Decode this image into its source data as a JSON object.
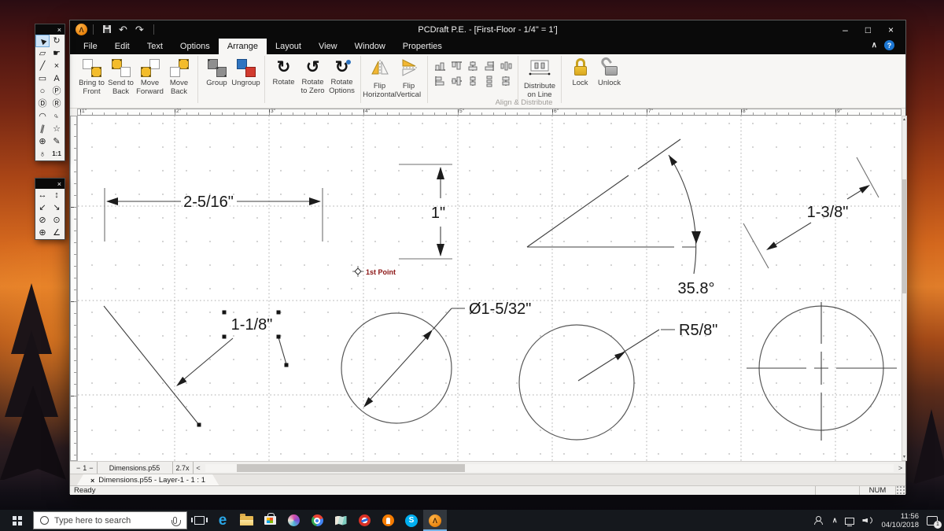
{
  "titlebar": {
    "title": "PCDraft P.E. - [First-Floor - 1/4\" = 1']",
    "minimize": "–",
    "maximize": "□",
    "close": "×",
    "undo": "↶",
    "redo": "↷"
  },
  "menu": {
    "tabs": [
      "File",
      "Edit",
      "Text",
      "Options",
      "Arrange",
      "Layout",
      "View",
      "Window",
      "Properties"
    ],
    "collapse_glyph": "∧",
    "help_glyph": "?"
  },
  "ribbon": {
    "group_label": "Align & Distribute",
    "bring_to_front": "Bring to Front",
    "send_to_back": "Send to Back",
    "move_forward": "Move Forward",
    "move_back": "Move Back",
    "group": "Group",
    "ungroup": "Ungroup",
    "rotate": "Rotate",
    "rotate_to_zero": "Rotate to Zero",
    "rotate_options": "Rotate Options",
    "rotate_glyph": "↻",
    "rotate_zero_glyph": "↺",
    "rotate_options_glyph": "↻",
    "flip_horizontal": "Flip Horizontal",
    "flip_vertical": "Flip Vertical",
    "distribute_on_line": "Distribute on Line",
    "lock": "Lock",
    "unlock": "Unlock"
  },
  "palette1": {
    "close": "×",
    "tools": [
      {
        "name": "select",
        "glyph": "▶"
      },
      {
        "name": "rotate",
        "glyph": "↻"
      },
      {
        "name": "reshape",
        "glyph": "▱"
      },
      {
        "name": "pan",
        "glyph": "☛"
      },
      {
        "name": "line",
        "glyph": "╱"
      },
      {
        "name": "break",
        "glyph": "×"
      },
      {
        "name": "rectangle",
        "glyph": "▭"
      },
      {
        "name": "text",
        "glyph": "A"
      },
      {
        "name": "ellipse",
        "glyph": "○"
      },
      {
        "name": "polygon",
        "glyph": "Ⓟ"
      },
      {
        "name": "door",
        "glyph": "Ⓓ"
      },
      {
        "name": "roof",
        "glyph": "Ⓡ"
      },
      {
        "name": "freeform",
        "glyph": "◠"
      },
      {
        "name": "mirror",
        "glyph": "♀"
      },
      {
        "name": "parallel-lines",
        "glyph": "∥"
      },
      {
        "name": "star",
        "glyph": "☆"
      },
      {
        "name": "symbol",
        "glyph": "⊕"
      },
      {
        "name": "pen",
        "glyph": "✎"
      },
      {
        "name": "callout",
        "glyph": "♁"
      },
      {
        "name": "actual-size",
        "glyph": "1:1"
      }
    ]
  },
  "palette2": {
    "close": "×",
    "tools": [
      {
        "name": "dim-horizontal",
        "glyph": "↔"
      },
      {
        "name": "dim-vertical",
        "glyph": "↕"
      },
      {
        "name": "dim-aligned",
        "glyph": "↙"
      },
      {
        "name": "dim-rotated",
        "glyph": "↘"
      },
      {
        "name": "dim-diameter",
        "glyph": "⊘"
      },
      {
        "name": "dim-radius",
        "glyph": "⊙"
      },
      {
        "name": "center-mark",
        "glyph": "⊕"
      },
      {
        "name": "dim-angle",
        "glyph": "∠"
      }
    ]
  },
  "ruler": {
    "labels": [
      "1\"",
      "2\"",
      "3\"",
      "4\"",
      "5\"",
      "6\"",
      "7\"",
      "8\"",
      "9\""
    ]
  },
  "canvas": {
    "dim_linear_h": "2-5/16\"",
    "dim_linear_v": "1\"",
    "dim_angle": "35.8°",
    "dim_aligned": "1-3/8\"",
    "dim_leader": "1-1/8\"",
    "dim_diameter": "Ø1-5/32\"",
    "dim_radius": "R5/8\"",
    "cursor_hint": "1st Point"
  },
  "scrollbar": {
    "up": "▲",
    "down": "▼",
    "left": "<",
    "right": ">"
  },
  "bottombar": {
    "page_prev": "−",
    "page": "1",
    "page_next": "−",
    "doc_button": "Dimensions.p55",
    "zoom_button": "2.7x"
  },
  "doctab": {
    "close": "×",
    "label": "Dimensions.p55 - Layer-1 - 1 : 1"
  },
  "statusbar": {
    "message": "Ready",
    "num": "NUM"
  },
  "taskbar": {
    "search_placeholder": "Type here to search",
    "edge_glyph": "e",
    "skype_glyph": "S",
    "app_glyph": "Λ",
    "time": "11:56",
    "date": "04/10/2018",
    "notification_count": "1",
    "chevron": "∧"
  }
}
